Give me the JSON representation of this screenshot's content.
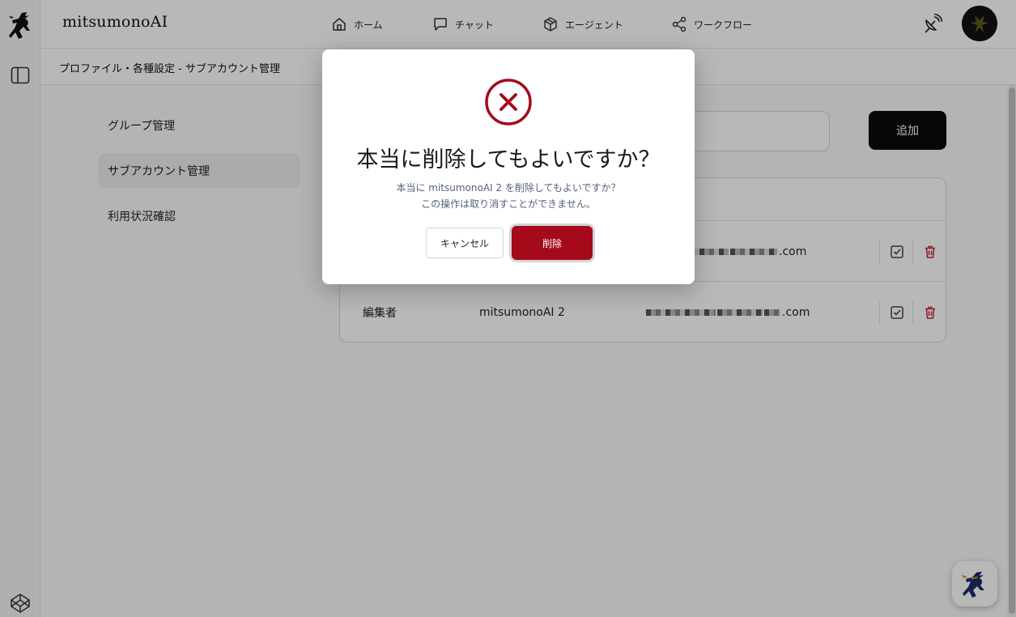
{
  "app": {
    "brand": "mitsumonoAI"
  },
  "nav": {
    "home": "ホーム",
    "chat": "チャット",
    "agent": "エージェント",
    "workflow": "ワークフロー"
  },
  "breadcrumb": "プロファイル・各種設定 - サブアカウント管理",
  "side_menu": [
    {
      "label": "グループ管理"
    },
    {
      "label": "サブアカウント管理"
    },
    {
      "label": "利用状況確認"
    }
  ],
  "toolbar": {
    "add_label": "追加"
  },
  "table": {
    "rows": [
      {
        "role": "",
        "name": "",
        "email_suffix": ".com"
      },
      {
        "role": "編集者",
        "name": "mitsumonoAI 2",
        "email_suffix": ".com"
      }
    ]
  },
  "dialog": {
    "title": "本当に削除してもよいですか？",
    "message_line1": "本当に mitsumonoAI 2 を削除してもよいですか？",
    "message_line2": "この操作は取り消すことができません。",
    "cancel_label": "キャンセル",
    "delete_label": "削除"
  },
  "colors": {
    "danger": "#a50a1b",
    "primary_button": "#0a0a0a",
    "active_menu": "#ededf1"
  }
}
